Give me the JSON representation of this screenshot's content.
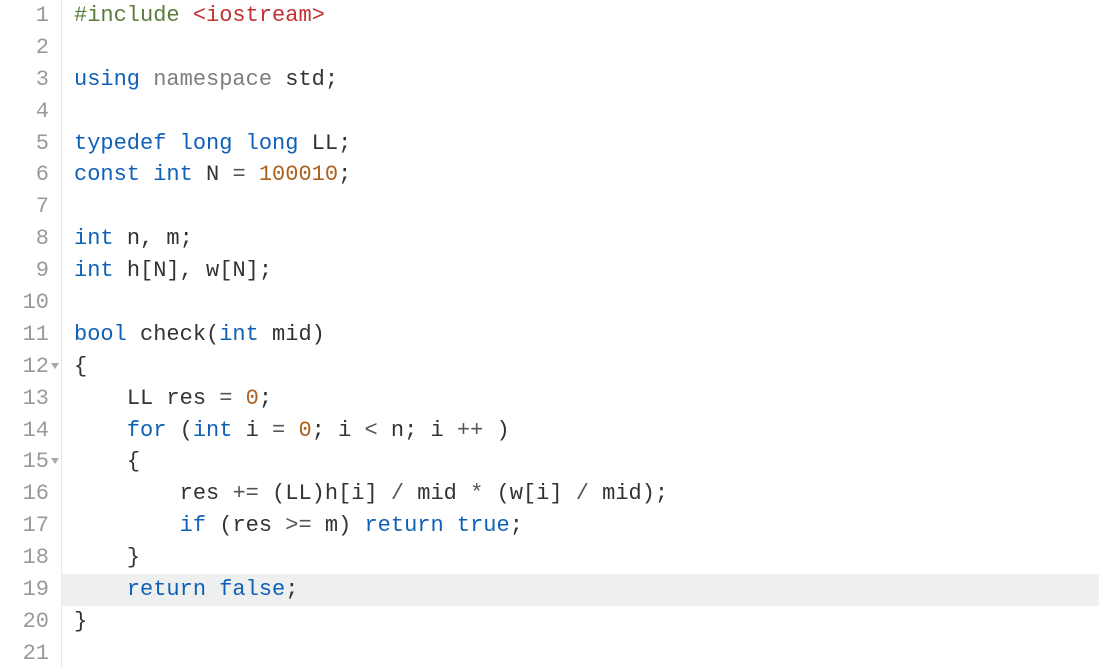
{
  "lines": [
    {
      "num": "1",
      "fold": false,
      "hl": false,
      "tokens": [
        {
          "t": "#include ",
          "c": "pp"
        },
        {
          "t": "<iostream>",
          "c": "inc"
        }
      ]
    },
    {
      "num": "2",
      "fold": false,
      "hl": false,
      "tokens": []
    },
    {
      "num": "3",
      "fold": false,
      "hl": false,
      "tokens": [
        {
          "t": "using ",
          "c": "kw"
        },
        {
          "t": "namespace ",
          "c": "ns"
        },
        {
          "t": "std",
          "c": "id"
        },
        {
          "t": ";",
          "c": "punc"
        }
      ]
    },
    {
      "num": "4",
      "fold": false,
      "hl": false,
      "tokens": []
    },
    {
      "num": "5",
      "fold": false,
      "hl": false,
      "tokens": [
        {
          "t": "typedef ",
          "c": "kw"
        },
        {
          "t": "long ",
          "c": "ty"
        },
        {
          "t": "long ",
          "c": "ty"
        },
        {
          "t": "LL",
          "c": "id"
        },
        {
          "t": ";",
          "c": "punc"
        }
      ]
    },
    {
      "num": "6",
      "fold": false,
      "hl": false,
      "tokens": [
        {
          "t": "const ",
          "c": "kw"
        },
        {
          "t": "int ",
          "c": "ty"
        },
        {
          "t": "N ",
          "c": "id"
        },
        {
          "t": "= ",
          "c": "op"
        },
        {
          "t": "100010",
          "c": "num"
        },
        {
          "t": ";",
          "c": "punc"
        }
      ]
    },
    {
      "num": "7",
      "fold": false,
      "hl": false,
      "tokens": []
    },
    {
      "num": "8",
      "fold": false,
      "hl": false,
      "tokens": [
        {
          "t": "int ",
          "c": "ty"
        },
        {
          "t": "n",
          "c": "id"
        },
        {
          "t": ", ",
          "c": "punc"
        },
        {
          "t": "m",
          "c": "id"
        },
        {
          "t": ";",
          "c": "punc"
        }
      ]
    },
    {
      "num": "9",
      "fold": false,
      "hl": false,
      "tokens": [
        {
          "t": "int ",
          "c": "ty"
        },
        {
          "t": "h",
          "c": "id"
        },
        {
          "t": "[",
          "c": "punc"
        },
        {
          "t": "N",
          "c": "id"
        },
        {
          "t": "], ",
          "c": "punc"
        },
        {
          "t": "w",
          "c": "id"
        },
        {
          "t": "[",
          "c": "punc"
        },
        {
          "t": "N",
          "c": "id"
        },
        {
          "t": "];",
          "c": "punc"
        }
      ]
    },
    {
      "num": "10",
      "fold": false,
      "hl": false,
      "tokens": []
    },
    {
      "num": "11",
      "fold": false,
      "hl": false,
      "tokens": [
        {
          "t": "bool ",
          "c": "ty"
        },
        {
          "t": "check",
          "c": "fn"
        },
        {
          "t": "(",
          "c": "punc"
        },
        {
          "t": "int ",
          "c": "ty"
        },
        {
          "t": "mid",
          "c": "id"
        },
        {
          "t": ")",
          "c": "punc"
        }
      ]
    },
    {
      "num": "12",
      "fold": true,
      "hl": false,
      "tokens": [
        {
          "t": "{",
          "c": "punc"
        }
      ]
    },
    {
      "num": "13",
      "fold": false,
      "hl": false,
      "tokens": [
        {
          "t": "    ",
          "c": ""
        },
        {
          "t": "LL ",
          "c": "id"
        },
        {
          "t": "res ",
          "c": "id"
        },
        {
          "t": "= ",
          "c": "op"
        },
        {
          "t": "0",
          "c": "num"
        },
        {
          "t": ";",
          "c": "punc"
        }
      ]
    },
    {
      "num": "14",
      "fold": false,
      "hl": false,
      "tokens": [
        {
          "t": "    ",
          "c": ""
        },
        {
          "t": "for ",
          "c": "kw"
        },
        {
          "t": "(",
          "c": "punc"
        },
        {
          "t": "int ",
          "c": "ty"
        },
        {
          "t": "i ",
          "c": "id"
        },
        {
          "t": "= ",
          "c": "op"
        },
        {
          "t": "0",
          "c": "num"
        },
        {
          "t": "; ",
          "c": "punc"
        },
        {
          "t": "i ",
          "c": "id"
        },
        {
          "t": "< ",
          "c": "op"
        },
        {
          "t": "n",
          "c": "id"
        },
        {
          "t": "; ",
          "c": "punc"
        },
        {
          "t": "i ",
          "c": "id"
        },
        {
          "t": "++ ",
          "c": "op"
        },
        {
          "t": ")",
          "c": "punc"
        }
      ]
    },
    {
      "num": "15",
      "fold": true,
      "hl": false,
      "tokens": [
        {
          "t": "    ",
          "c": ""
        },
        {
          "t": "{",
          "c": "punc"
        }
      ]
    },
    {
      "num": "16",
      "fold": false,
      "hl": false,
      "tokens": [
        {
          "t": "        ",
          "c": ""
        },
        {
          "t": "res ",
          "c": "id"
        },
        {
          "t": "+= ",
          "c": "op"
        },
        {
          "t": "(",
          "c": "punc"
        },
        {
          "t": "LL",
          "c": "id"
        },
        {
          "t": ")",
          "c": "punc"
        },
        {
          "t": "h",
          "c": "id"
        },
        {
          "t": "[",
          "c": "punc"
        },
        {
          "t": "i",
          "c": "id"
        },
        {
          "t": "] ",
          "c": "punc"
        },
        {
          "t": "/ ",
          "c": "op"
        },
        {
          "t": "mid ",
          "c": "id"
        },
        {
          "t": "* ",
          "c": "op"
        },
        {
          "t": "(",
          "c": "punc"
        },
        {
          "t": "w",
          "c": "id"
        },
        {
          "t": "[",
          "c": "punc"
        },
        {
          "t": "i",
          "c": "id"
        },
        {
          "t": "] ",
          "c": "punc"
        },
        {
          "t": "/ ",
          "c": "op"
        },
        {
          "t": "mid",
          "c": "id"
        },
        {
          "t": ");",
          "c": "punc"
        }
      ]
    },
    {
      "num": "17",
      "fold": false,
      "hl": false,
      "tokens": [
        {
          "t": "        ",
          "c": ""
        },
        {
          "t": "if ",
          "c": "kw"
        },
        {
          "t": "(",
          "c": "punc"
        },
        {
          "t": "res ",
          "c": "id"
        },
        {
          "t": ">= ",
          "c": "op"
        },
        {
          "t": "m",
          "c": "id"
        },
        {
          "t": ") ",
          "c": "punc"
        },
        {
          "t": "return ",
          "c": "kw"
        },
        {
          "t": "true",
          "c": "bool"
        },
        {
          "t": ";",
          "c": "punc"
        }
      ]
    },
    {
      "num": "18",
      "fold": false,
      "hl": false,
      "tokens": [
        {
          "t": "    ",
          "c": ""
        },
        {
          "t": "}",
          "c": "punc"
        }
      ]
    },
    {
      "num": "19",
      "fold": false,
      "hl": true,
      "tokens": [
        {
          "t": "    ",
          "c": ""
        },
        {
          "t": "return ",
          "c": "kw"
        },
        {
          "t": "false",
          "c": "bool"
        },
        {
          "t": ";",
          "c": "punc"
        }
      ]
    },
    {
      "num": "20",
      "fold": false,
      "hl": false,
      "tokens": [
        {
          "t": "}",
          "c": "punc"
        }
      ]
    },
    {
      "num": "21",
      "fold": false,
      "hl": false,
      "tokens": []
    }
  ]
}
